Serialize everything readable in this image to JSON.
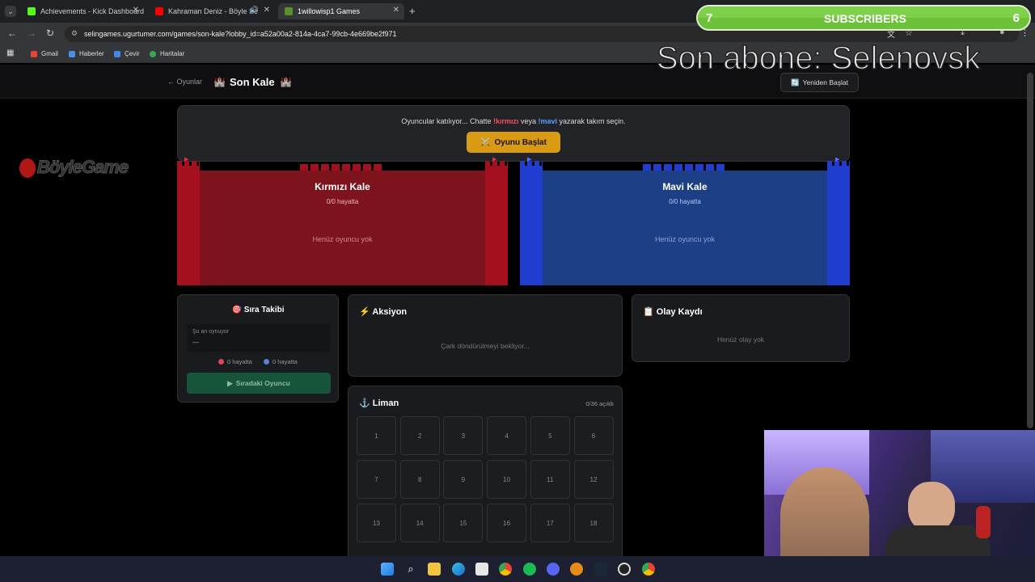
{
  "browser": {
    "tabs": [
      {
        "label": "Achievements - Kick Dashboard",
        "color": "#53fc18"
      },
      {
        "label": "Kahraman Deniz - Böyle Se",
        "color": "#ff0000"
      },
      {
        "label": "1willowisp1 Games",
        "color": "#5a8f2a"
      }
    ],
    "url": "selingames.ugurtumer.com/games/son-kale?lobby_id=a52a00a2-814a-4ca7-99cb-4e669be2f971",
    "bookmarks": [
      "Gmail",
      "Haberler",
      "Çevir",
      "Haritalar"
    ]
  },
  "overlay": {
    "subscribers_left": "7",
    "subscribers_label": "SUBSCRIBERS",
    "subscribers_right": "6",
    "last_sub_text": "Son abone: Selenovsk"
  },
  "header": {
    "back_link": "← Oyunlar",
    "title_icon": "🏰",
    "title": "Son Kale",
    "title_icon_right": "🏰",
    "restart_label": "Yeniden Başlat",
    "restart_icon": "🔄"
  },
  "banner": {
    "text_pre": "Oyuncular katılıyor... Chatte ",
    "cmd_red": "!kırmızı",
    "text_mid": " veya ",
    "cmd_blue": "!mavi",
    "text_post": " yazarak takım seçin.",
    "start_icon": "⚔️",
    "start_label": "Oyunu Başlat"
  },
  "castles": {
    "red": {
      "title": "Kırmızı Kale",
      "alive": "0/0 hayatta",
      "empty": "Henüz oyuncu yok",
      "color": "#a5101e"
    },
    "blue": {
      "title": "Mavi Kale",
      "alive": "0/0 hayatta",
      "empty": "Henüz oyuncu yok",
      "color": "#1f3ed0"
    }
  },
  "turn_panel": {
    "title_icon": "🎯",
    "title": "Sıra Takibi",
    "current_label": "Şu an oynuyor",
    "current_value": "—",
    "red_alive": "0 hayatta",
    "blue_alive": "0 hayatta",
    "next_label": "Sıradaki Oyuncu",
    "next_icon": "▶"
  },
  "action_panel": {
    "icon": "⚡",
    "title": "Aksiyon",
    "status": "Çark döndürülmeyi bekliyor..."
  },
  "log_panel": {
    "icon": "📋",
    "title": "Olay Kaydı",
    "empty": "Henüz olay yok"
  },
  "harbor": {
    "icon": "⚓",
    "title": "Liman",
    "counter": "0/36 açıldı",
    "cells": [
      "1",
      "2",
      "3",
      "4",
      "5",
      "6",
      "7",
      "8",
      "9",
      "10",
      "11",
      "12",
      "13",
      "14",
      "15",
      "16",
      "17",
      "18"
    ]
  },
  "brand_watermark": "BöyleGame"
}
